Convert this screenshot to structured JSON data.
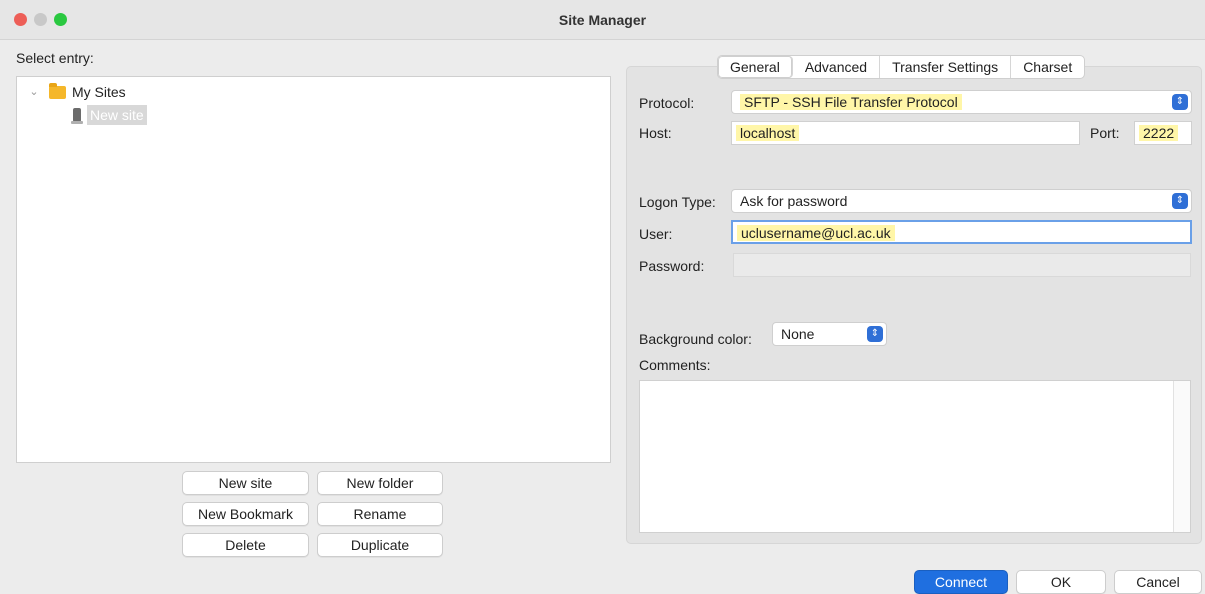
{
  "window": {
    "title": "Site Manager",
    "traffic_lights": {
      "close": "#ed5e57",
      "minimize": "#c8c8c8",
      "zoom": "#2ac840"
    }
  },
  "left": {
    "select_label": "Select entry:",
    "tree": {
      "root_label": "My Sites",
      "child_label": "New site"
    },
    "buttons": {
      "new_site": "New site",
      "new_folder": "New folder",
      "new_bookmark": "New Bookmark",
      "rename": "Rename",
      "delete": "Delete",
      "duplicate": "Duplicate"
    }
  },
  "tabs": [
    "General",
    "Advanced",
    "Transfer Settings",
    "Charset"
  ],
  "general": {
    "protocol_label": "Protocol:",
    "protocol_value": "SFTP - SSH File Transfer Protocol",
    "host_label": "Host:",
    "host_value": "localhost",
    "port_label": "Port:",
    "port_value": "2222",
    "logon_type_label": "Logon Type:",
    "logon_type_value": "Ask for password",
    "user_label": "User:",
    "user_value": "uclusername@ucl.ac.uk",
    "password_label": "Password:",
    "bgcolor_label": "Background color:",
    "bgcolor_value": "None",
    "comments_label": "Comments:"
  },
  "footer": {
    "connect": "Connect",
    "ok": "OK",
    "cancel": "Cancel"
  },
  "icons": {
    "stepper": "⇕",
    "chevron": "⌄"
  }
}
